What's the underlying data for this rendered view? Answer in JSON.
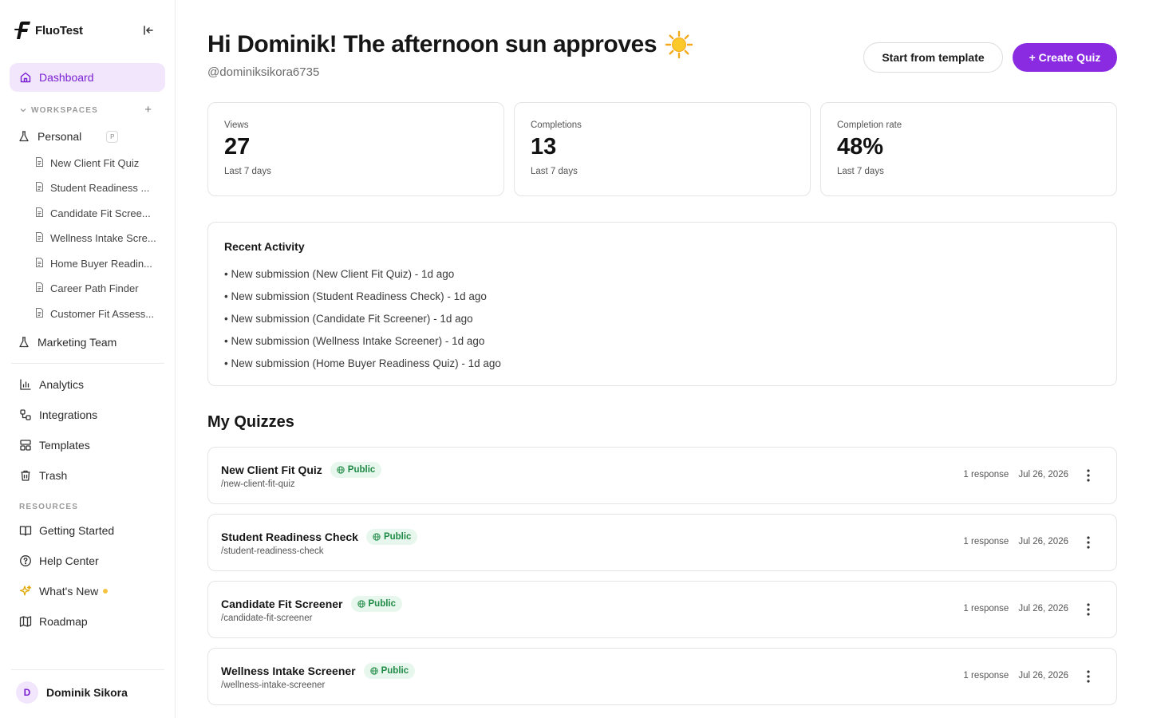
{
  "app": {
    "name": "FluoTest"
  },
  "sidebar": {
    "dashboard_label": "Dashboard",
    "workspaces_label": "WORKSPACES",
    "workspaces": [
      {
        "name": "Personal",
        "badge": "P",
        "quizzes": [
          "New Client Fit Quiz",
          "Student Readiness ...",
          "Candidate Fit Scree...",
          "Wellness Intake Scre...",
          "Home Buyer Readin...",
          "Career Path Finder",
          "Customer Fit Assess..."
        ]
      },
      {
        "name": "Marketing Team"
      }
    ],
    "nav": [
      {
        "label": "Analytics",
        "icon": "bar-chart-icon"
      },
      {
        "label": "Integrations",
        "icon": "integrations-icon"
      },
      {
        "label": "Templates",
        "icon": "template-icon"
      },
      {
        "label": "Trash",
        "icon": "trash-icon"
      }
    ],
    "resources_label": "RESOURCES",
    "resources": [
      {
        "label": "Getting Started",
        "icon": "book-icon"
      },
      {
        "label": "Help Center",
        "icon": "help-icon"
      },
      {
        "label": "What's New",
        "icon": "sparkles-icon"
      },
      {
        "label": "Roadmap",
        "icon": "map-icon"
      }
    ],
    "user": {
      "initial": "D",
      "name": "Dominik Sikora"
    }
  },
  "header": {
    "greeting": "Hi Dominik! The afternoon sun approves",
    "handle": "@dominiksikora6735",
    "template_button": "Start from template",
    "create_button": "+ Create Quiz"
  },
  "stats": [
    {
      "label": "Views",
      "value": "27",
      "sub": "Last 7 days"
    },
    {
      "label": "Completions",
      "value": "13",
      "sub": "Last 7 days"
    },
    {
      "label": "Completion rate",
      "value": "48%",
      "sub": "Last 7 days"
    }
  ],
  "activity": {
    "title": "Recent Activity",
    "items": [
      "• New submission (New Client Fit Quiz) - 1d ago",
      "• New submission (Student Readiness Check) - 1d ago",
      "• New submission (Candidate Fit Screener) - 1d ago",
      "• New submission (Wellness Intake Screener) - 1d ago",
      "• New submission (Home Buyer Readiness Quiz) - 1d ago"
    ]
  },
  "quizzes": {
    "title": "My Quizzes",
    "items": [
      {
        "name": "New Client Fit Quiz",
        "visibility": "Public",
        "slug": "/new-client-fit-quiz",
        "responses": "1 response",
        "date": "Jul 26, 2026"
      },
      {
        "name": "Student Readiness Check",
        "visibility": "Public",
        "slug": "/student-readiness-check",
        "responses": "1 response",
        "date": "Jul 26, 2026"
      },
      {
        "name": "Candidate Fit Screener",
        "visibility": "Public",
        "slug": "/candidate-fit-screener",
        "responses": "1 response",
        "date": "Jul 26, 2026"
      },
      {
        "name": "Wellness Intake Screener",
        "visibility": "Public",
        "slug": "/wellness-intake-screener",
        "responses": "1 response",
        "date": "Jul 26, 2026"
      }
    ]
  },
  "colors": {
    "accent": "#8a2be2",
    "accent_soft": "#f1e6fb",
    "public_badge": "#1f8a46"
  }
}
